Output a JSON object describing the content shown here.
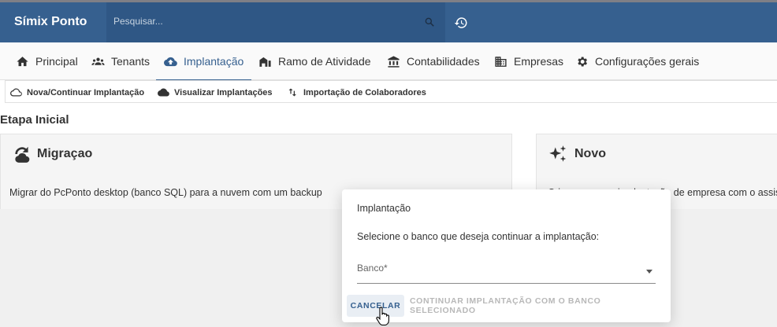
{
  "app": {
    "title": "Símix Ponto"
  },
  "search": {
    "placeholder": "Pesquisar...",
    "icon": "search-icon"
  },
  "header": {
    "history_icon": "history-icon"
  },
  "tabs": [
    {
      "label": "Principal",
      "icon": "home-icon"
    },
    {
      "label": "Tenants",
      "icon": "people-icon"
    },
    {
      "label": "Implantação",
      "icon": "cloud-upload-icon",
      "active": true
    },
    {
      "label": "Ramo de Atividade",
      "icon": "building-icon"
    },
    {
      "label": "Contabilidades",
      "icon": "bank-icon"
    },
    {
      "label": "Empresas",
      "icon": "company-icon"
    },
    {
      "label": "Configurações gerais",
      "icon": "gear-icon"
    }
  ],
  "subtabs": [
    {
      "label": "Nova/Continuar Implantação",
      "icon": "cloud-outline-icon"
    },
    {
      "label": "Visualizar Implantações",
      "icon": "cloud-icon"
    },
    {
      "label": "Importação de Colaboradores",
      "icon": "swap-vertical-icon"
    }
  ],
  "main": {
    "stage_title": "Etapa Inicial",
    "cards": [
      {
        "title": "Migraçao",
        "description": "Migrar do PcPonto desktop (banco SQL) para a nuvem com um backup",
        "icon": "cloud-sync-icon"
      },
      {
        "title": "Novo",
        "description": "Criar uma nova implantação de empresa com o assistente",
        "icon": "sparkles-icon"
      }
    ]
  },
  "dialog": {
    "title": "Implantação",
    "message": "Selecione o banco que deseja continuar a implantação:",
    "select_label": "Banco*",
    "cancel_label": "CANCELAR",
    "continue_label": "CONTINUAR IMPLANTAÇÃO COM O BANCO SELECIONADO"
  },
  "colors": {
    "primary": "#36608f",
    "search_bg": "#2f5785",
    "disabled_text": "#b8b8b8"
  }
}
